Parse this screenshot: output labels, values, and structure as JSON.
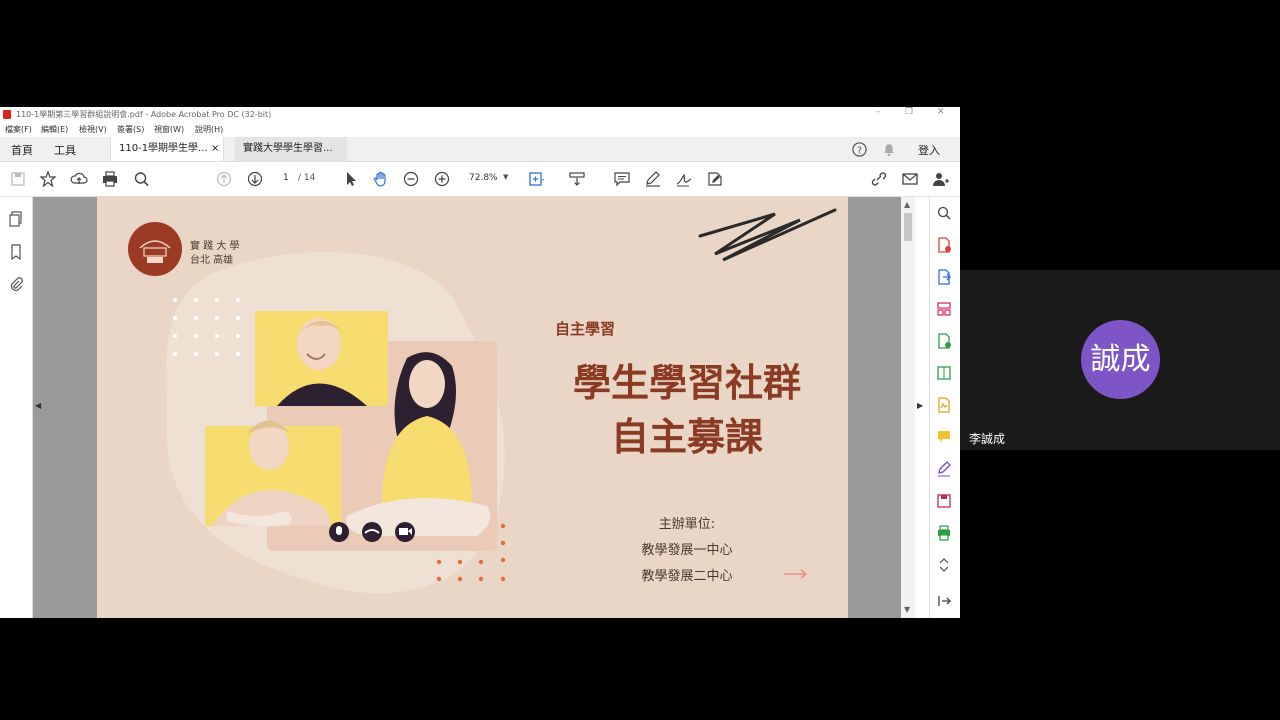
{
  "window": {
    "title": "110-1學期第三學習群組說明會.pdf - Adobe Acrobat Pro DC (32-bit)",
    "controls": [
      "–",
      "❐",
      "✕"
    ]
  },
  "menu": [
    "檔案(F)",
    "編輯(E)",
    "檢視(V)",
    "簽署(S)",
    "視窗(W)",
    "說明(H)"
  ],
  "tabs": {
    "home": "首頁",
    "tools": "工具",
    "doc_tabs": [
      {
        "label": "110-1學期學生學...",
        "close": "×"
      },
      {
        "label": "實踐大學學生學習..."
      }
    ],
    "signin": "登入"
  },
  "toolbar": {
    "page_current": "1",
    "page_total": "/ 14",
    "zoom": "72.8%"
  },
  "slide": {
    "logo_line1": "實 踐 大 學",
    "logo_line2": "台北  高雄",
    "subtitle": "自主學習",
    "title_line1": "學生學習社群",
    "title_line2": "自主募課",
    "organizer_label": "主辦單位:",
    "organizer1": "教學發展一中心",
    "organizer2": "教學發展二中心"
  },
  "participant": {
    "avatar_text": "誠成",
    "name": "李誠成",
    "avatar_color": "#7d55c7"
  },
  "colors": {
    "slide_bg": "#e9d6c6",
    "title_color": "#8b3a24",
    "accent_yellow": "#f7dc6f",
    "dot_orange": "#e06b3f"
  }
}
